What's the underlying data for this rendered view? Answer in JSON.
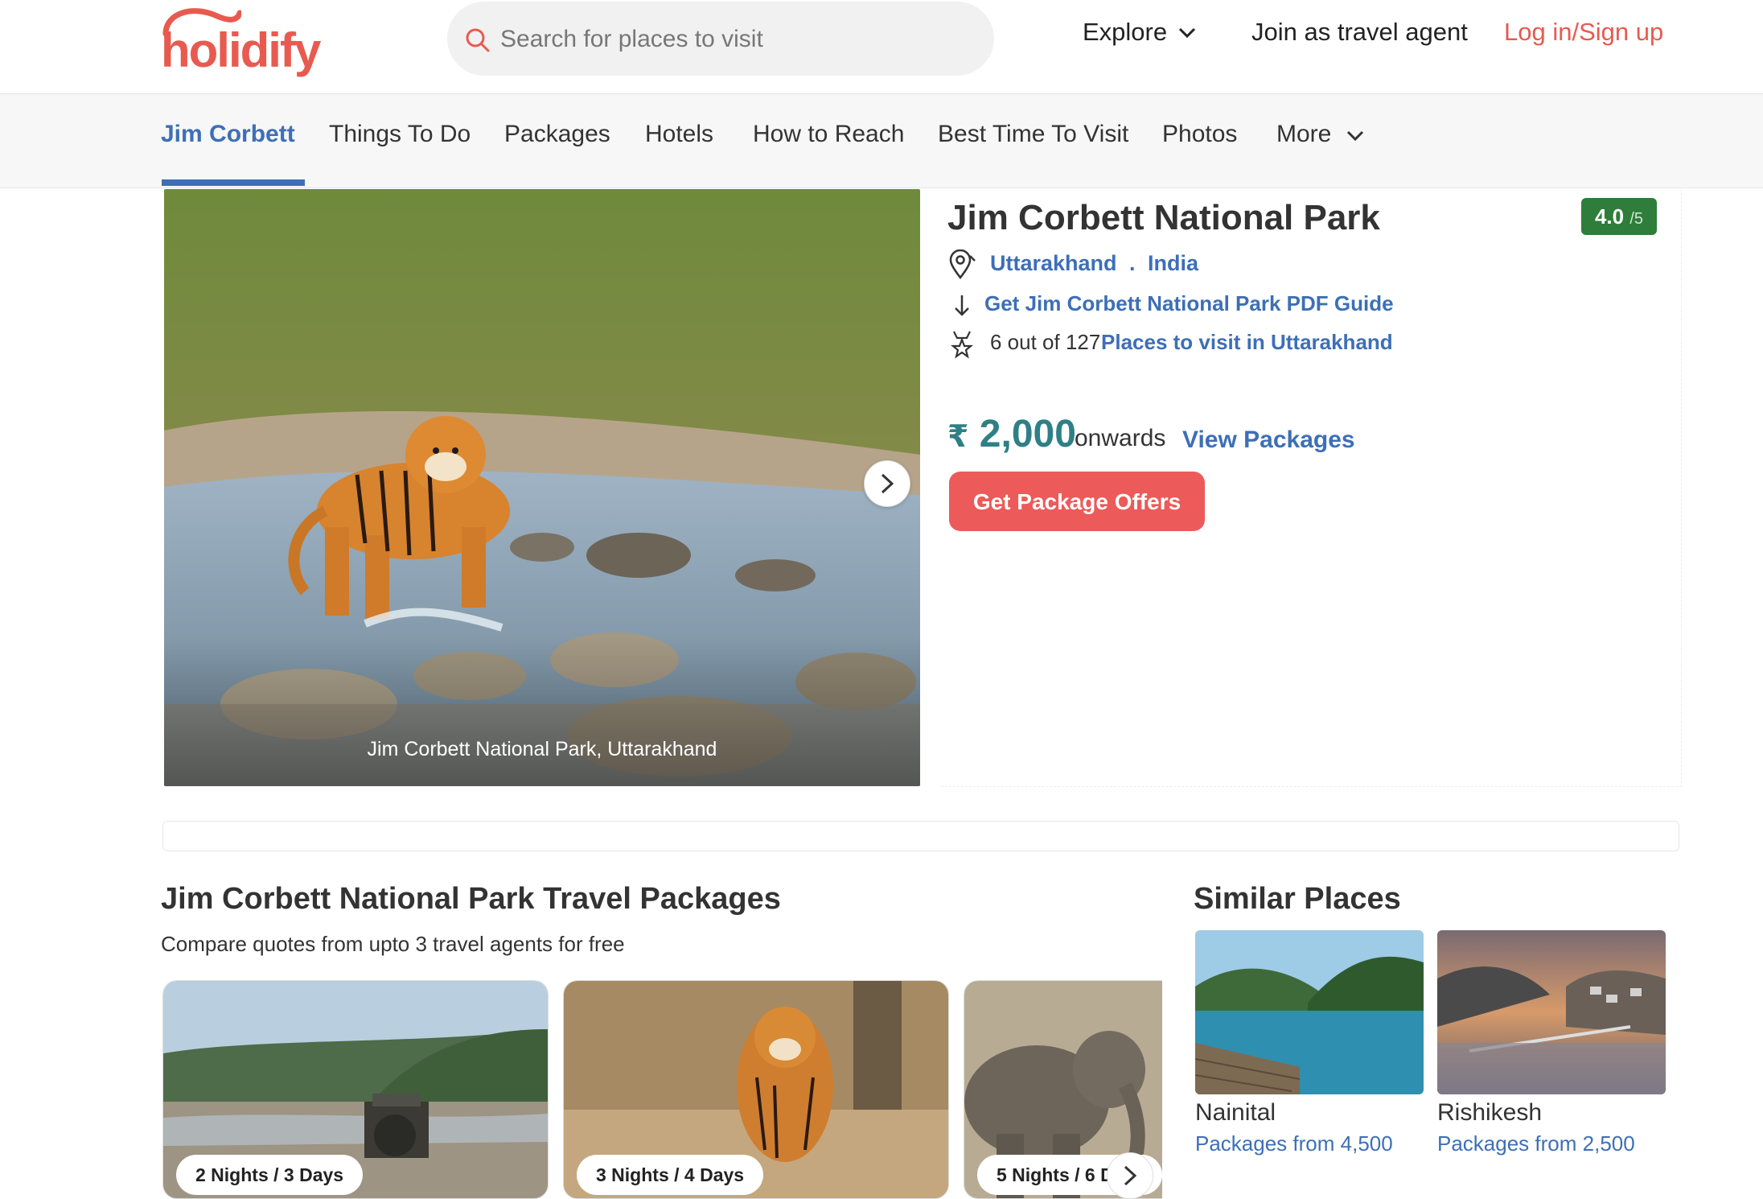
{
  "brand": {
    "logo_text": "holidify"
  },
  "search": {
    "placeholder": "Search for places to visit"
  },
  "topnav": {
    "explore": "Explore",
    "agent": "Join as travel agent",
    "login": "Log in/Sign up"
  },
  "tabs": [
    "Jim Corbett",
    "Things To Do",
    "Packages",
    "Hotels",
    "How to Reach",
    "Best Time To Visit",
    "Photos",
    "More"
  ],
  "hero": {
    "caption": "Jim Corbett National Park, Uttarakhand"
  },
  "place": {
    "title": "Jim Corbett National Park",
    "rating": "4.0",
    "rating_max": "/5",
    "state": "Uttarakhand",
    "separator": ".",
    "country": "India",
    "pdf_link": "Get Jim Corbett National Park PDF Guide",
    "rank_text": "6 out of 127",
    "rank_link": "Places to visit in Uttarakhand",
    "price_symbol": "₹",
    "price": "2,000",
    "price_suffix": "onwards",
    "view_packages": "View Packages",
    "offers_button": "Get Package Offers"
  },
  "packages": {
    "title": "Jim Corbett National Park Travel Packages",
    "subtitle": "Compare quotes from upto 3 travel agents for free",
    "cards": [
      {
        "duration": "2 Nights / 3 Days"
      },
      {
        "duration": "3 Nights / 4 Days"
      },
      {
        "duration": "5 Nights / 6 D"
      }
    ]
  },
  "similar": {
    "title": "Similar Places",
    "places": [
      {
        "name": "Nainital",
        "price": "Packages from 4,500"
      },
      {
        "name": "Rishikesh",
        "price": "Packages from 2,500"
      }
    ]
  },
  "colors": {
    "accent": "#3d6fb6",
    "brand": "#e85a4f",
    "rating": "#2e7d3a",
    "price": "#2f7f86"
  },
  "icons": [
    "search-icon",
    "chevron-down-icon",
    "location-pin-icon",
    "download-icon",
    "award-icon",
    "chevron-right-icon"
  ]
}
